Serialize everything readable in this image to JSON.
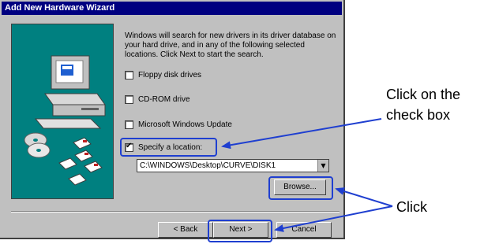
{
  "window": {
    "title": "Add New Hardware Wizard",
    "description": "Windows will search for new drivers in its driver database on your hard drive, and in any of the following selected locations. Click Next to start the search."
  },
  "options": [
    {
      "label": "Floppy disk drives",
      "checked": false
    },
    {
      "label": "CD-ROM drive",
      "checked": false
    },
    {
      "label": "Microsoft Windows Update",
      "checked": false
    },
    {
      "label": "Specify a location:",
      "checked": true
    }
  ],
  "location_path": "C:\\WINDOWS\\Desktop\\CURVE\\DISK1",
  "buttons": {
    "browse": "Browse...",
    "back": "< Back",
    "next": "Next >",
    "cancel": "Cancel"
  },
  "annotations": {
    "checkbox_line1": "Click on the",
    "checkbox_line2": "check box",
    "click": "Click"
  },
  "colors": {
    "highlight": "#1f3fd0",
    "titlebar": "#000080",
    "illustration_bg": "#008080"
  }
}
